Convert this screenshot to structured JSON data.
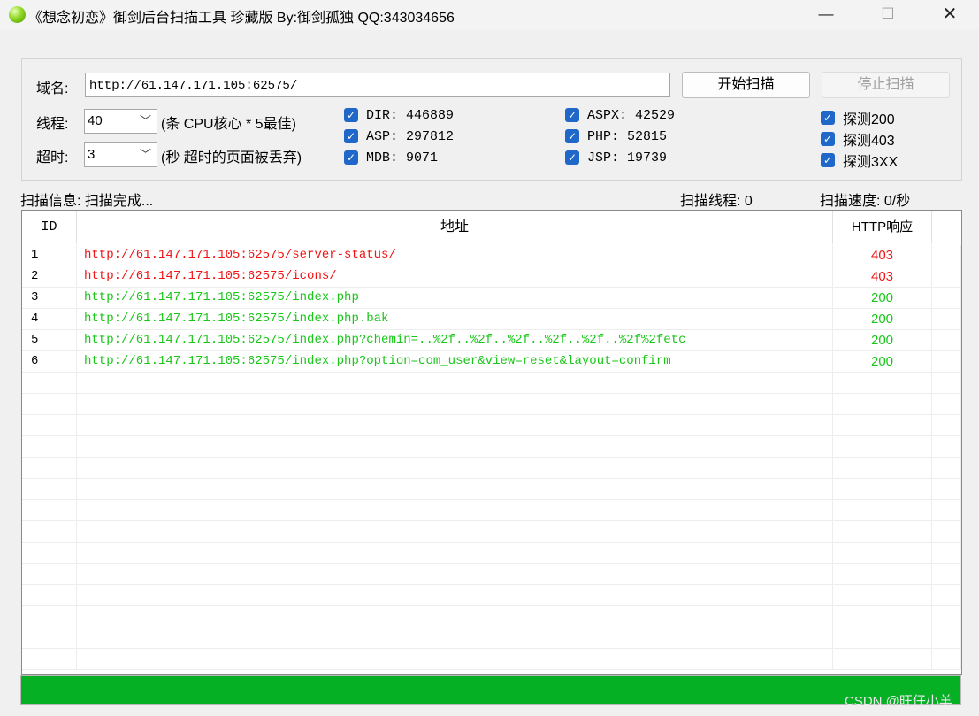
{
  "window": {
    "title": "《想念初恋》御剑后台扫描工具 珍藏版 By:御剑孤独 QQ:343034656",
    "minimize": "—",
    "maximize": "☐",
    "close": "✕"
  },
  "form": {
    "domain_label": "域名:",
    "domain_value": "http://61.147.171.105:62575/",
    "threads_label": "线程:",
    "threads_value": "40",
    "threads_hint": "(条 CPU核心 * 5最佳)",
    "timeout_label": "超时:",
    "timeout_value": "3",
    "timeout_hint": "(秒 超时的页面被丢弃)",
    "start_button": "开始扫描",
    "stop_button": "停止扫描"
  },
  "dictionaries": [
    {
      "label": "DIR: 446889",
      "checked": true
    },
    {
      "label": "ASP: 297812",
      "checked": true
    },
    {
      "label": "MDB: 9071",
      "checked": true
    },
    {
      "label": "ASPX: 42529",
      "checked": true
    },
    {
      "label": "PHP: 52815",
      "checked": true
    },
    {
      "label": "JSP: 19739",
      "checked": true
    }
  ],
  "probes": [
    {
      "label": "探测200",
      "checked": true
    },
    {
      "label": "探测403",
      "checked": true
    },
    {
      "label": "探测3XX",
      "checked": true
    }
  ],
  "status": {
    "info": "扫描信息: 扫描完成...",
    "threads": "扫描线程: 0",
    "speed": "扫描速度: 0/秒"
  },
  "table": {
    "headers": [
      "ID",
      "地址",
      "HTTP响应"
    ],
    "rows": [
      {
        "id": "1",
        "url": "http://61.147.171.105:62575/server-status/",
        "code": "403"
      },
      {
        "id": "2",
        "url": "http://61.147.171.105:62575/icons/",
        "code": "403"
      },
      {
        "id": "3",
        "url": "http://61.147.171.105:62575/index.php",
        "code": "200"
      },
      {
        "id": "4",
        "url": "http://61.147.171.105:62575/index.php.bak",
        "code": "200"
      },
      {
        "id": "5",
        "url": "http://61.147.171.105:62575/index.php?chemin=..%2f..%2f..%2f..%2f..%2f..%2f%2fetc",
        "code": "200"
      },
      {
        "id": "6",
        "url": "http://61.147.171.105:62575/index.php?option=com_user&view=reset&layout=confirm",
        "code": "200"
      }
    ]
  },
  "progress": {
    "percent": 100
  },
  "colors": {
    "code_403": "#f01414",
    "code_200": "#19c619",
    "progress": "#06b025",
    "checkbox": "#1f67c8"
  },
  "watermark": "CSDN @旺仔小羊"
}
